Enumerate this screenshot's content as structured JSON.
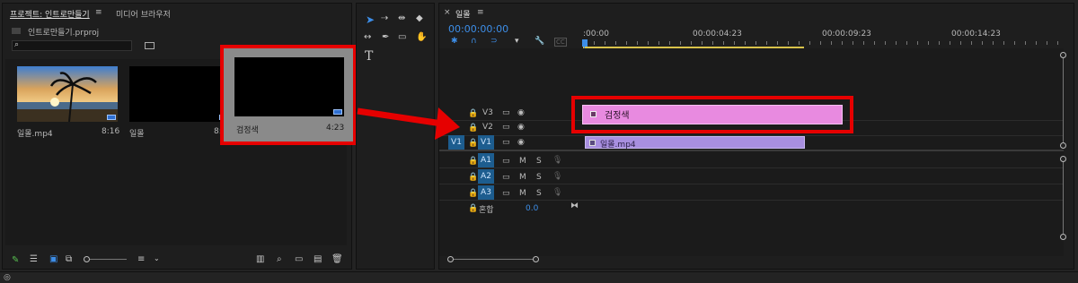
{
  "project_panel": {
    "tab_project": "프로젝트: 인트로만들기",
    "tab_menu": "≡",
    "tab_media_browser": "미디어 브라우저",
    "project_file": "인트로만들기.prproj",
    "search_placeholder": "",
    "items": [
      {
        "name": "일몰.mp4",
        "duration": "8:16"
      },
      {
        "name": "일몰",
        "duration": "8:"
      },
      {
        "name": "검정색",
        "duration": "4:23"
      }
    ]
  },
  "tools": {
    "text_tool": "T"
  },
  "timeline": {
    "close": "×",
    "tab_name": "일몰",
    "tab_menu": "≡",
    "timecode": "00:00:00:00",
    "ruler_labels": [
      ":00:00",
      "00:00:04:23",
      "00:00:09:23",
      "00:00:14:23"
    ],
    "video_tracks": [
      {
        "name": "V3",
        "source": ""
      },
      {
        "name": "V2",
        "source": ""
      },
      {
        "name": "V1",
        "source": "V1"
      }
    ],
    "audio_tracks": [
      {
        "name": "A1",
        "m": "M",
        "s": "S"
      },
      {
        "name": "A2",
        "m": "M",
        "s": "S"
      },
      {
        "name": "A3",
        "m": "M",
        "s": "S"
      }
    ],
    "mix_label": "혼합",
    "mix_value": "0.0",
    "clips": {
      "v2_clip": "검정색",
      "v1_clip": "일몰.mp4"
    }
  },
  "colors": {
    "timecode_blue": "#3d8ee8",
    "clip_pink": "#e88ae0",
    "clip_purple": "#a88fe0",
    "highlight_red": "#e60000"
  }
}
